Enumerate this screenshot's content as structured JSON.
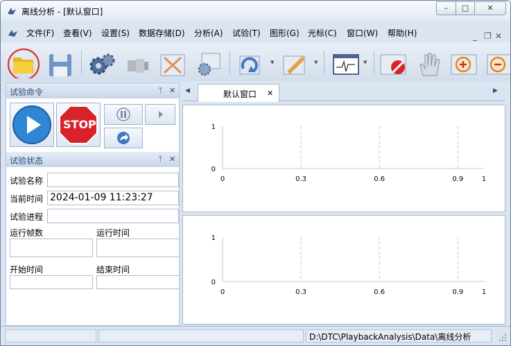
{
  "window": {
    "title": "离线分析 - [默认窗口]",
    "controls": {
      "minimize": "–",
      "maximize": "□",
      "close": "✕"
    }
  },
  "menu": [
    "文件(F)",
    "查看(V)",
    "设置(S)",
    "数据存储(D)",
    "分析(A)",
    "试验(T)",
    "图形(G)",
    "光标(C)",
    "窗口(W)",
    "帮助(H)"
  ],
  "mdi_controls": [
    "_",
    "❐",
    "✕"
  ],
  "toolbar": {
    "icons": [
      "open-folder-icon",
      "save-icon",
      "settings-gears-icon",
      "connect-plug-icon",
      "chart-cancel-icon",
      "channel-gears-icon",
      "refresh-icon",
      "edit-pen-icon",
      "waveform-icon",
      "stop-display-icon",
      "hand-pan-icon",
      "zoom-in-icon",
      "zoom-out-icon"
    ]
  },
  "command_panel": {
    "title": "试验命令",
    "pin": "ᛘ",
    "close": "✕",
    "stop_label": "STOP"
  },
  "status_panel": {
    "title": "试验状态",
    "pin": "ᛘ",
    "close": "✕",
    "name_label": "试验名称",
    "name_value": "",
    "time_label": "当前时间",
    "time_value": "2024-01-09 11:23:27",
    "progress_label": "试验进程",
    "progress_value": "",
    "frames_label": "运行帧数",
    "frames_value": "",
    "runtime_label": "运行时间",
    "runtime_value": "",
    "start_label": "开始时间",
    "start_value": "",
    "end_label": "结束时间",
    "end_value": ""
  },
  "doc_tabs": {
    "active": "默认窗口",
    "close": "✕",
    "nav_left": "◀",
    "nav_right": "▶"
  },
  "chart_data": [
    {
      "type": "line",
      "x_ticks": [
        "0",
        "0.3",
        "0.6",
        "0.9",
        "1"
      ],
      "y_ticks": [
        "0",
        "1"
      ],
      "xlim": [
        0,
        1
      ],
      "ylim": [
        0,
        1
      ],
      "series": [],
      "grid": "vertical dashed"
    },
    {
      "type": "line",
      "x_ticks": [
        "0",
        "0.3",
        "0.6",
        "0.9",
        "1"
      ],
      "y_ticks": [
        "0",
        "1"
      ],
      "xlim": [
        0,
        1
      ],
      "ylim": [
        0,
        1
      ],
      "series": [],
      "grid": "vertical dashed"
    }
  ],
  "statusbar": {
    "path": "D:\\DTC\\PlaybackAnalysis\\Data\\离线分析"
  },
  "colors": {
    "stop_red": "#d8232a",
    "play_blue": "#2f86d4",
    "highlight_ring": "#e03030",
    "panel_header_text": "#2c4a7a"
  }
}
